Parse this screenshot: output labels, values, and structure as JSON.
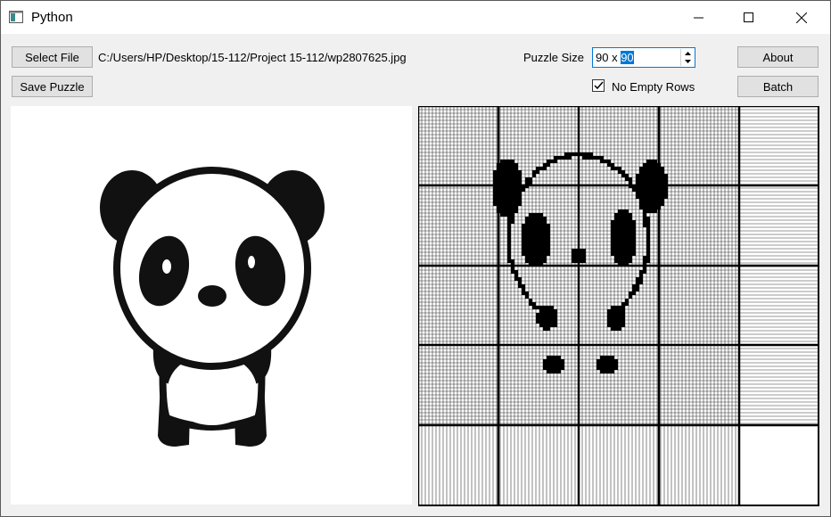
{
  "window": {
    "title": "Python",
    "icon": "app-window-icon"
  },
  "toolbar": {
    "select_file_label": "Select File",
    "save_puzzle_label": "Save Puzzle",
    "file_path": "C:/Users/HP/Desktop/15-112/Project 15-112/wp2807625.jpg",
    "puzzle_size_label": "Puzzle Size",
    "puzzle_size_prefix": "90 x ",
    "puzzle_size_selected": "90",
    "no_empty_rows_label": "No Empty Rows",
    "no_empty_rows_checked": true,
    "about_label": "About",
    "batch_label": "Batch"
  },
  "panes": {
    "source_image": "panda-image",
    "puzzle_grid": "nonogram-grid"
  }
}
